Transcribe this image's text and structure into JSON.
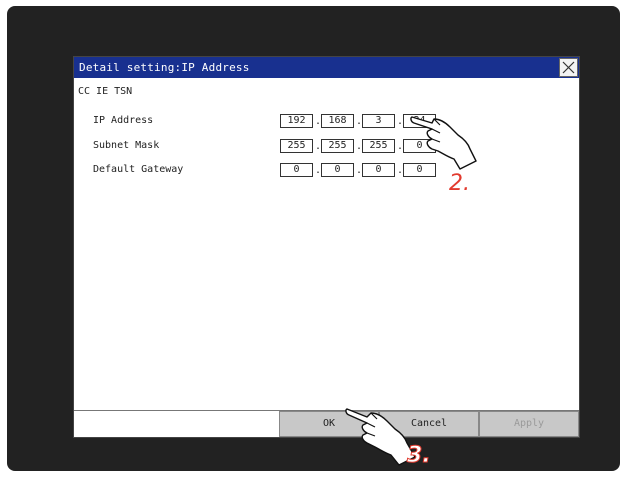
{
  "dialog": {
    "title": "Detail setting:IP Address",
    "section": "CC IE TSN"
  },
  "fields": {
    "ip_address": {
      "label": "IP Address",
      "octets": [
        "192",
        "168",
        "3",
        "24"
      ]
    },
    "subnet_mask": {
      "label": "Subnet Mask",
      "octets": [
        "255",
        "255",
        "255",
        "0"
      ]
    },
    "default_gateway": {
      "label": "Default Gateway",
      "octets": [
        "0",
        "0",
        "0",
        "0"
      ]
    }
  },
  "separator": ".",
  "buttons": {
    "ok": "OK",
    "cancel": "Cancel",
    "apply": "Apply"
  },
  "annotations": {
    "step2": "2.",
    "step3": "3."
  },
  "icons": {
    "close": "close-x-icon",
    "pointer": "pointing-hand-icon"
  },
  "colors": {
    "titlebar": "#18308f",
    "screen": "#222222",
    "callout": "#e23a2e",
    "button": "#c8c8c8"
  }
}
